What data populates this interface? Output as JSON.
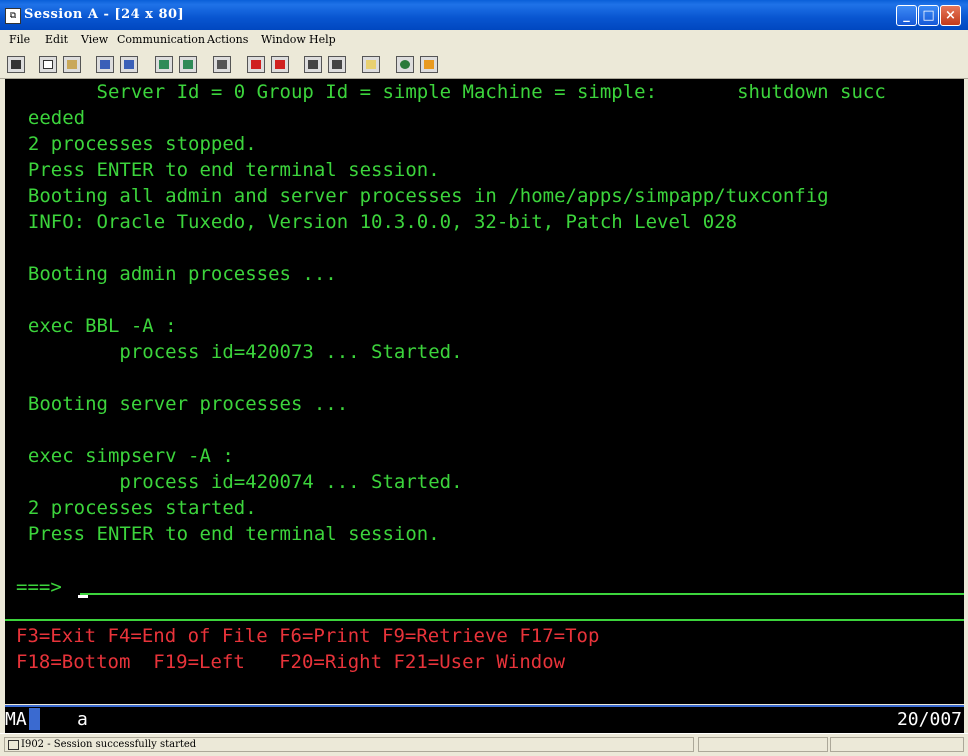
{
  "window": {
    "title": "Session A - [24 x 80]",
    "app_icon_text": "⧉",
    "buttons": [
      "minimize",
      "maximize",
      "close"
    ]
  },
  "menubar": {
    "items": [
      {
        "label": "File",
        "accel": "F"
      },
      {
        "label": "Edit",
        "accel": "E"
      },
      {
        "label": "View",
        "accel": "V"
      },
      {
        "label": "Communication",
        "accel": "C"
      },
      {
        "label": "Actions",
        "accel": "A"
      },
      {
        "label": "Window",
        "accel": "W"
      },
      {
        "label": "Help",
        "accel": "H"
      }
    ]
  },
  "toolbar": {
    "icons": [
      "print-screen-icon",
      "copy-icon",
      "paste-icon",
      "send-file-icon",
      "receive-file-icon",
      "display-keypad-icon",
      "display-settings-icon",
      "record-macro-icon",
      "stop-macro-icon",
      "play-macro-icon",
      "run-script-icon",
      "connect-icon",
      "disconnect-icon",
      "clipboard-icon",
      "globe-icon",
      "help-tag-icon"
    ]
  },
  "terminal": {
    "lines": [
      "        Server Id = 0 Group Id = simple Machine = simple:       shutdown succ",
      "  eeded",
      "  2 processes stopped.",
      "  Press ENTER to end terminal session.",
      "  Booting all admin and server processes in /home/apps/simpapp/tuxconfig",
      "  INFO: Oracle Tuxedo, Version 10.3.0.0, 32-bit, Patch Level 028",
      "",
      "  Booting admin processes ...",
      "",
      "  exec BBL -A :",
      "          process id=420073 ... Started.",
      "",
      "  Booting server processes ...",
      "",
      "  exec simpserv -A :",
      "          process id=420074 ... Started.",
      "  2 processes started.",
      "  Press ENTER to end terminal session."
    ],
    "prompt": "===>",
    "input_value": "",
    "function_keys": [
      "F3=Exit F4=End of File F6=Print F9=Retrieve F17=Top",
      "F18=Bottom  F19=Left   F20=Right F21=User Window"
    ]
  },
  "oia": {
    "session_indicator": "MA",
    "input_mode": "a",
    "cursor_position": "20/007"
  },
  "statusbar": {
    "message": "I902 - Session successfully started"
  },
  "colors": {
    "terminal_text": "#3CD43C",
    "function_key_text": "#E8333A",
    "terminal_background": "#000000",
    "titlebar": "#0A5FD8"
  }
}
